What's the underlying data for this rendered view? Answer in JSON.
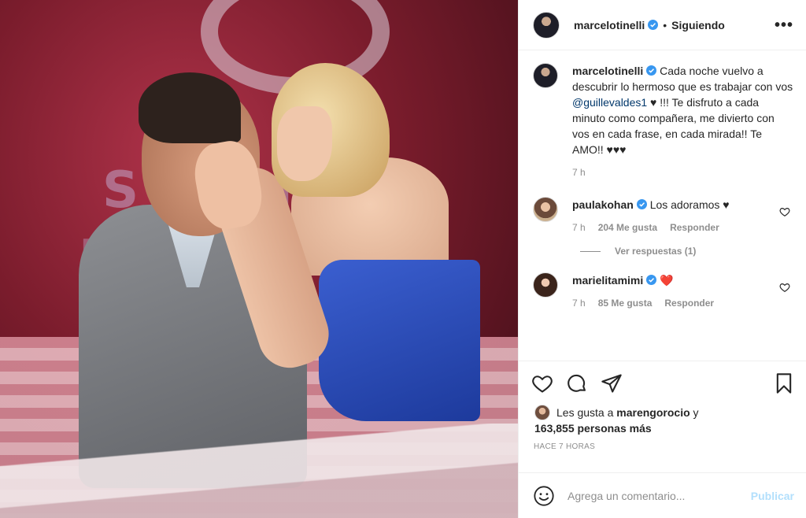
{
  "post": {
    "image_alt": "Photo of a couple embracing on a TV stage"
  },
  "header": {
    "username": "marcelotinelli",
    "separator": "•",
    "follow_label": "Siguiendo",
    "more_label": "•••"
  },
  "caption": {
    "username": "marcelotinelli",
    "text_before": "Cada noche vuelvo a descubrir lo hermoso que es trabajar con vos ",
    "mention": "@guillevaldes1",
    "text_after": " ♥ !!! Te disfruto a cada minuto como compañera, me divierto con vos en cada frase, en cada mirada!! Te AMO!! ♥♥♥",
    "time": "7 h"
  },
  "comments": [
    {
      "username": "paulakohan",
      "text": "Los adoramos ♥",
      "time": "7 h",
      "likes": "204 Me gusta",
      "reply_label": "Responder",
      "view_replies": "Ver respuestas (1)"
    },
    {
      "username": "marielitamimi",
      "text": "❤️",
      "time": "7 h",
      "likes": "85 Me gusta",
      "reply_label": "Responder"
    }
  ],
  "likes": {
    "prefix": "Les gusta a ",
    "user": "marengorocio",
    "conj": " y",
    "count": "163,855 personas más"
  },
  "timeago": "HACE 7 HORAS",
  "add_comment": {
    "placeholder": "Agrega un comentario...",
    "post_label": "Publicar"
  },
  "colors": {
    "verified": "#3897f0",
    "red_heart": "#ed4956",
    "publish_disabled": "#b2dffc"
  }
}
